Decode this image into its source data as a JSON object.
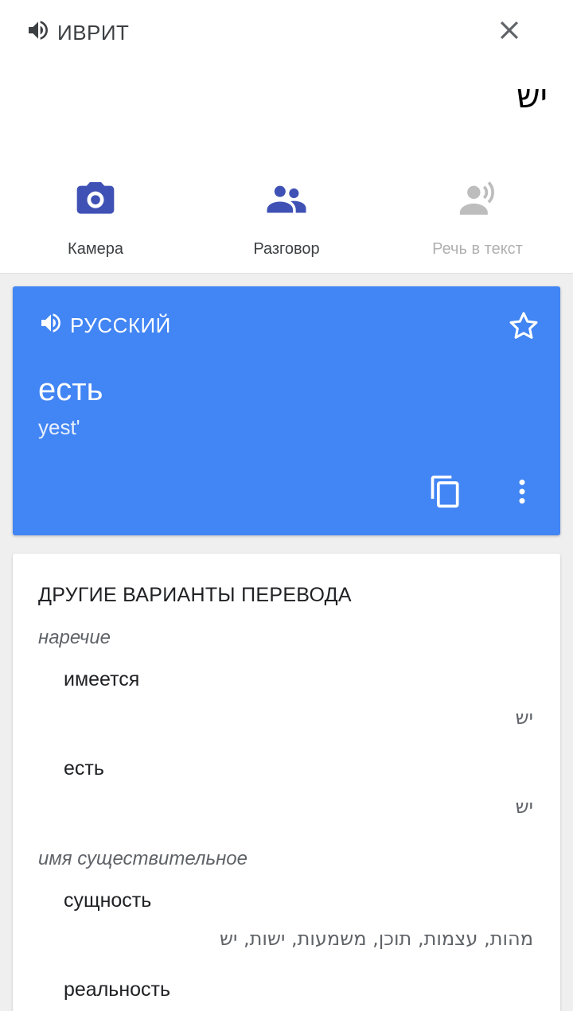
{
  "source": {
    "language_label": "ИВРИТ",
    "text": "יש"
  },
  "tools": [
    {
      "label": "Камера",
      "icon": "camera-icon",
      "enabled": true
    },
    {
      "label": "Разговор",
      "icon": "conversation-icon",
      "enabled": true
    },
    {
      "label": "Речь в текст",
      "icon": "speech-to-text-icon",
      "enabled": false
    }
  ],
  "result": {
    "language_label": "РУССКИЙ",
    "translation": "есть",
    "transliteration": "yest'"
  },
  "alternatives": {
    "title": "ДРУГИЕ ВАРИАНТЫ ПЕРЕВОДА",
    "groups": [
      {
        "pos": "наречие",
        "entries": [
          {
            "word": "имеется",
            "source": "יש"
          },
          {
            "word": "есть",
            "source": "יש"
          }
        ]
      },
      {
        "pos": "имя существительное",
        "entries": [
          {
            "word": "сущность",
            "source": "מהות, עצמות, תוכן, משמעות, ישות, יש"
          },
          {
            "word": "реальность",
            "source": ""
          }
        ]
      }
    ]
  },
  "colors": {
    "accent": "#4285f4",
    "icon_active": "#3f51b5",
    "icon_disabled": "#bdbdbd"
  }
}
